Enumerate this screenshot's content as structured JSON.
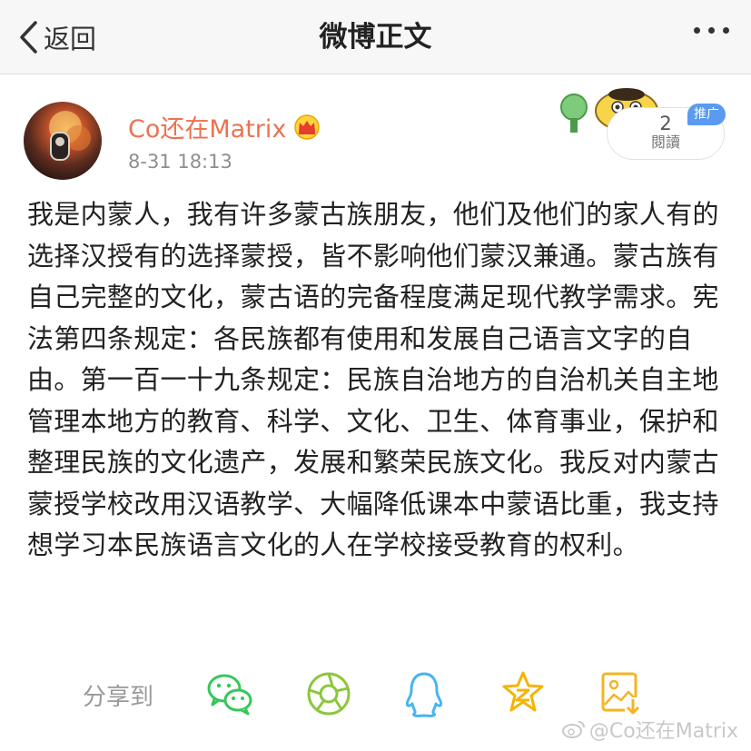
{
  "nav": {
    "back_label": "返回",
    "title": "微博正文",
    "more_icon": "more-dots-icon"
  },
  "post": {
    "username": "Co还在Matrix",
    "badge_icon": "crown-icon",
    "timestamp": "8-31 18:13",
    "read_count": "2",
    "read_label": "閱讀",
    "promote_label": "推广",
    "text": "我是内蒙人，我有许多蒙古族朋友，他们及他们的家人有的选择汉授有的选择蒙授，皆不影响他们蒙汉兼通。蒙古族有自己完整的文化，蒙古语的完备程度满足现代教学需求。宪法第四条规定：各民族都有使用和发展自己语言文字的自由。第一百一十九条规定：民族自治地方的自治机关自主地管理本地方的教育、科学、文化、卫生、体育事业，保护和整理民族的文化遗产，发展和繁荣民族文化。我反对内蒙古蒙授学校改用汉语教学、大幅降低课本中蒙语比重，我支持想学习本民族语言文化的人在学校接受教育的权利。"
  },
  "share": {
    "label": "分享到",
    "icons": [
      "wechat-icon",
      "moments-icon",
      "qq-icon",
      "qzone-icon",
      "save-image-icon"
    ]
  },
  "watermark": {
    "text": "@Co还在Matrix",
    "icon": "weibo-logo-icon"
  },
  "colors": {
    "username": "#eb7350",
    "wechat": "#35c759",
    "moments": "#8cc63e",
    "qq": "#48b5ee",
    "qzone": "#f5b400",
    "save": "#f4b423",
    "promo": "#5a9bef"
  }
}
